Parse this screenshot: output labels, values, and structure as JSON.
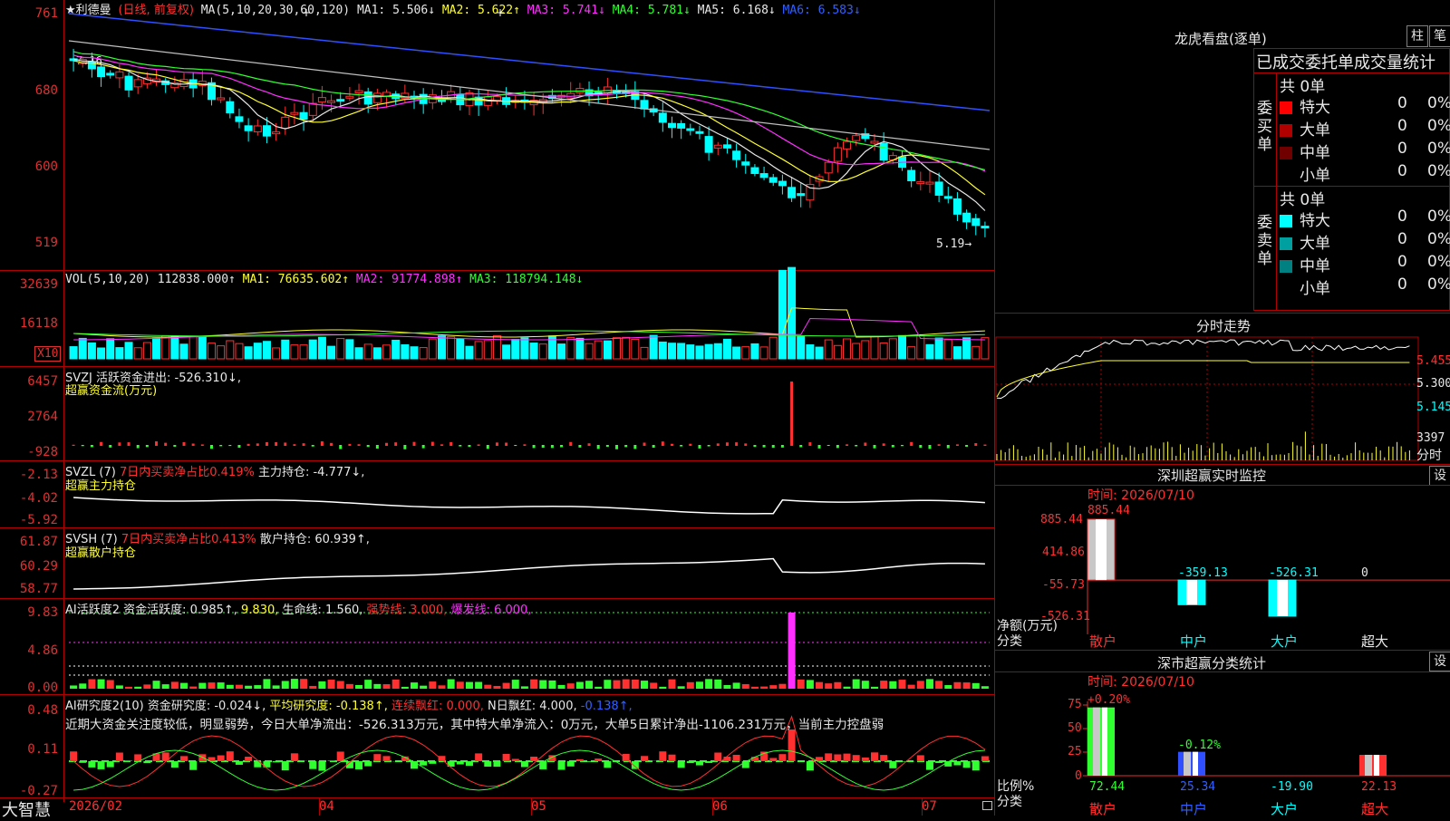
{
  "app": {
    "name": "大智慧"
  },
  "stock": {
    "name": "★利德曼",
    "mode": "(日线, 前复权)",
    "current_price_label": "5.19",
    "high_marker": "7.16"
  },
  "main_chart": {
    "ma_label": "MA(5,10,20,30,60,120)",
    "ma1": "MA1: 5.506↓",
    "ma2": "MA2: 5.622↑",
    "ma3": "MA3: 5.741↓",
    "ma4": "MA4: 5.781↓",
    "ma5": "MA5: 6.168↓",
    "ma6": "MA6: 6.583↓",
    "y_labels": [
      "761",
      "680",
      "600",
      "519"
    ]
  },
  "vol_panel": {
    "label": "VOL(5,10,20)",
    "value": "112838.000↑",
    "ma1": "MA1: 76635.602↑",
    "ma2": "MA2: 91774.898↑",
    "ma3": "MA3: 118794.148↓",
    "y_labels": [
      "32639",
      "16118"
    ],
    "unit": "X10"
  },
  "svzj_panel": {
    "label": "SVZJ  活跃资金进出: -526.310↓,",
    "sub": "超赢资金流(万元)",
    "y_labels": [
      "6457",
      "2764",
      "-928"
    ]
  },
  "svzl_panel": {
    "label_a": "SVZL (7)",
    "label_b": "7日内买卖净占比0.419%",
    "label_c": "主力持仓: -4.777↓,",
    "sub": "超赢主力持仓",
    "y_labels": [
      "-2.13",
      "-4.02",
      "-5.92"
    ]
  },
  "svsh_panel": {
    "label_a": "SVSH (7)",
    "label_b": "7日内买卖净占比0.413%",
    "label_c": "散户持仓: 60.939↑,",
    "sub": "超赢散户持仓",
    "y_labels": [
      "61.87",
      "60.29",
      "58.77"
    ]
  },
  "ai_active_panel": {
    "label_a": "AI活跃度2 资金活跃度: 0.985↑,",
    "label_b": "9.830,",
    "label_c": "生命线: 1.560,",
    "label_d": "强势线: 3.000,",
    "label_e": "爆发线: 6.000,",
    "y_labels": [
      "9.83",
      "4.86",
      "0.00"
    ]
  },
  "ai_research_panel": {
    "label_a": "AI研究度2(10) 资金研究度: -0.024↓,",
    "label_b": "平均研究度: -0.138↑,",
    "label_c": "连续飘红: 0.000,",
    "label_d": "N日飘红: 4.000,",
    "label_e": "-0.138↑,",
    "note": "近期大资金关注度较低，明显弱势，今日大单净流出：-526.313万元，其中特大单净流入：0万元，大单5日累计净出-1106.231万元，当前主力控盘弱",
    "y_labels": [
      "0.48",
      "0.11",
      "-0.27"
    ]
  },
  "x_axis": {
    "labels": [
      "2026/02",
      "04",
      "05",
      "06",
      "07"
    ]
  },
  "dragon_tiger": {
    "title": "龙虎看盘(逐单)",
    "btn_bar": "柱",
    "btn_pen": "笔",
    "header": "已成交委托单成交量统计",
    "buy_side": "委买单",
    "sell_side": "委卖单",
    "buy_total": "共 0单",
    "sell_total": "共 0单",
    "buy_rows": [
      {
        "label": "特大",
        "count": "0",
        "pct": "0%",
        "color": "#ff0000"
      },
      {
        "label": "大单",
        "count": "0",
        "pct": "0%",
        "color": "#b00000"
      },
      {
        "label": "中单",
        "count": "0",
        "pct": "0%",
        "color": "#700000"
      },
      {
        "label": "小单",
        "count": "0",
        "pct": "0%",
        "color": "#000000"
      }
    ],
    "sell_rows": [
      {
        "label": "特大",
        "count": "0",
        "pct": "0%",
        "color": "#00ffff"
      },
      {
        "label": "大单",
        "count": "0",
        "pct": "0%",
        "color": "#00a0a0"
      },
      {
        "label": "中单",
        "count": "0",
        "pct": "0%",
        "color": "#008080"
      },
      {
        "label": "小单",
        "count": "0",
        "pct": "0%",
        "color": "#000000"
      }
    ]
  },
  "intraday": {
    "title": "分时走势",
    "price_labels": [
      "5.455",
      "5.300",
      "5.145"
    ],
    "vol_label": "3397",
    "unit": "分时"
  },
  "sz_monitor": {
    "title": "深圳超赢实时监控",
    "btn": "设",
    "time": "时间: 2026/07/10",
    "y_labels": [
      "885.44",
      "414.86",
      "-55.73",
      "-526.31"
    ],
    "axis_title": "净额(万元)",
    "cat_title": "分类",
    "categories": [
      "散户",
      "中户",
      "大户",
      "超大"
    ],
    "values": [
      885.44,
      -359.13,
      -526.31,
      0
    ],
    "value_labels": [
      "885.44",
      "-359.13",
      "-526.31",
      "0"
    ]
  },
  "sz_class": {
    "title": "深市超赢分类统计",
    "btn": "设",
    "time": "时间: 2026/07/10",
    "y_labels": [
      "75",
      "50",
      "25",
      "0"
    ],
    "axis_title": "比例%",
    "cat_title": "分类",
    "categories": [
      "散户",
      "中户",
      "大户",
      "超大"
    ],
    "values": [
      72.44,
      25.34,
      -19.9,
      22.13
    ],
    "value_labels": [
      "72.44",
      "25.34",
      "-19.90",
      "22.13"
    ],
    "change_labels": [
      "+0.20%",
      "-0.12%"
    ]
  },
  "chart_data": [
    {
      "type": "bar",
      "title": "深圳超赢实时监控",
      "ylabel": "净额(万元)",
      "categories": [
        "散户",
        "中户",
        "大户",
        "超大"
      ],
      "values": [
        885.44,
        -359.13,
        -526.31,
        0
      ],
      "ylim": [
        -526.31,
        885.44
      ]
    },
    {
      "type": "bar",
      "title": "深市超赢分类统计",
      "ylabel": "比例%",
      "categories": [
        "散户",
        "中户",
        "大户",
        "超大"
      ],
      "values": [
        72.44,
        25.34,
        -19.9,
        22.13
      ],
      "ylim": [
        0,
        75
      ]
    }
  ]
}
